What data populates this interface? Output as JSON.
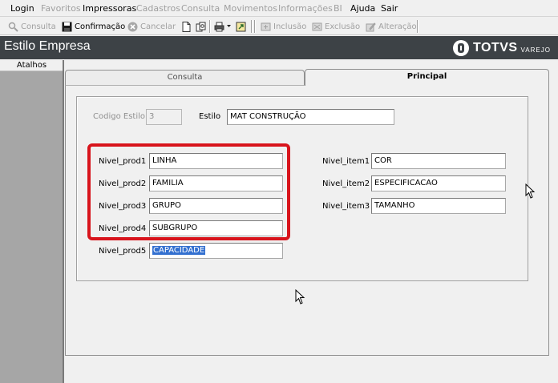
{
  "menu": {
    "items": [
      {
        "label": "Login",
        "enabled": true
      },
      {
        "label": "Favoritos",
        "enabled": false
      },
      {
        "label": "Impressoras",
        "enabled": true
      },
      {
        "label": "Cadastros",
        "enabled": false
      },
      {
        "label": "Consulta",
        "enabled": false
      },
      {
        "label": "Movimentos",
        "enabled": false
      },
      {
        "label": "Informações",
        "enabled": false
      },
      {
        "label": "BI",
        "enabled": false
      },
      {
        "label": "Ajuda",
        "enabled": true
      },
      {
        "label": "Sair",
        "enabled": true
      }
    ]
  },
  "toolbar": {
    "consulta": "Consulta",
    "confirmacao": "Confirmação",
    "cancelar": "Cancelar",
    "inclusao": "Inclusão",
    "exclusao": "Exclusão",
    "alteracao": "Alteração"
  },
  "window": {
    "title": "Estilo Empresa",
    "brand": "TOTVS",
    "brand_sub": "VAREJO"
  },
  "sidebar": {
    "header": "Atalhos"
  },
  "tabs": {
    "consulta": "Consulta",
    "principal": "Principal"
  },
  "form": {
    "codigo_label": "Codigo Estilo",
    "codigo_value": "3",
    "estilo_label": "Estilo",
    "estilo_value": "MAT CONSTRUÇÃO",
    "nivel_prod": [
      {
        "label": "Nivel_prod1",
        "value": "LINHA"
      },
      {
        "label": "Nivel_prod2",
        "value": "FAMILIA"
      },
      {
        "label": "Nivel_prod3",
        "value": "GRUPO"
      },
      {
        "label": "Nivel_prod4",
        "value": "SUBGRUPO"
      },
      {
        "label": "Nivel_prod5",
        "value": "CAPACIDADE"
      }
    ],
    "nivel_item": [
      {
        "label": "Nivel_item1",
        "value": "COR"
      },
      {
        "label": "Nivel_item2",
        "value": "ESPECIFICACAO"
      },
      {
        "label": "Nivel_item3",
        "value": "TAMANHO"
      }
    ]
  },
  "colors": {
    "titlebar": "#3d4246",
    "highlight": "#d8141c",
    "selection": "#3370d0",
    "sidebar": "#a6a6a6"
  }
}
